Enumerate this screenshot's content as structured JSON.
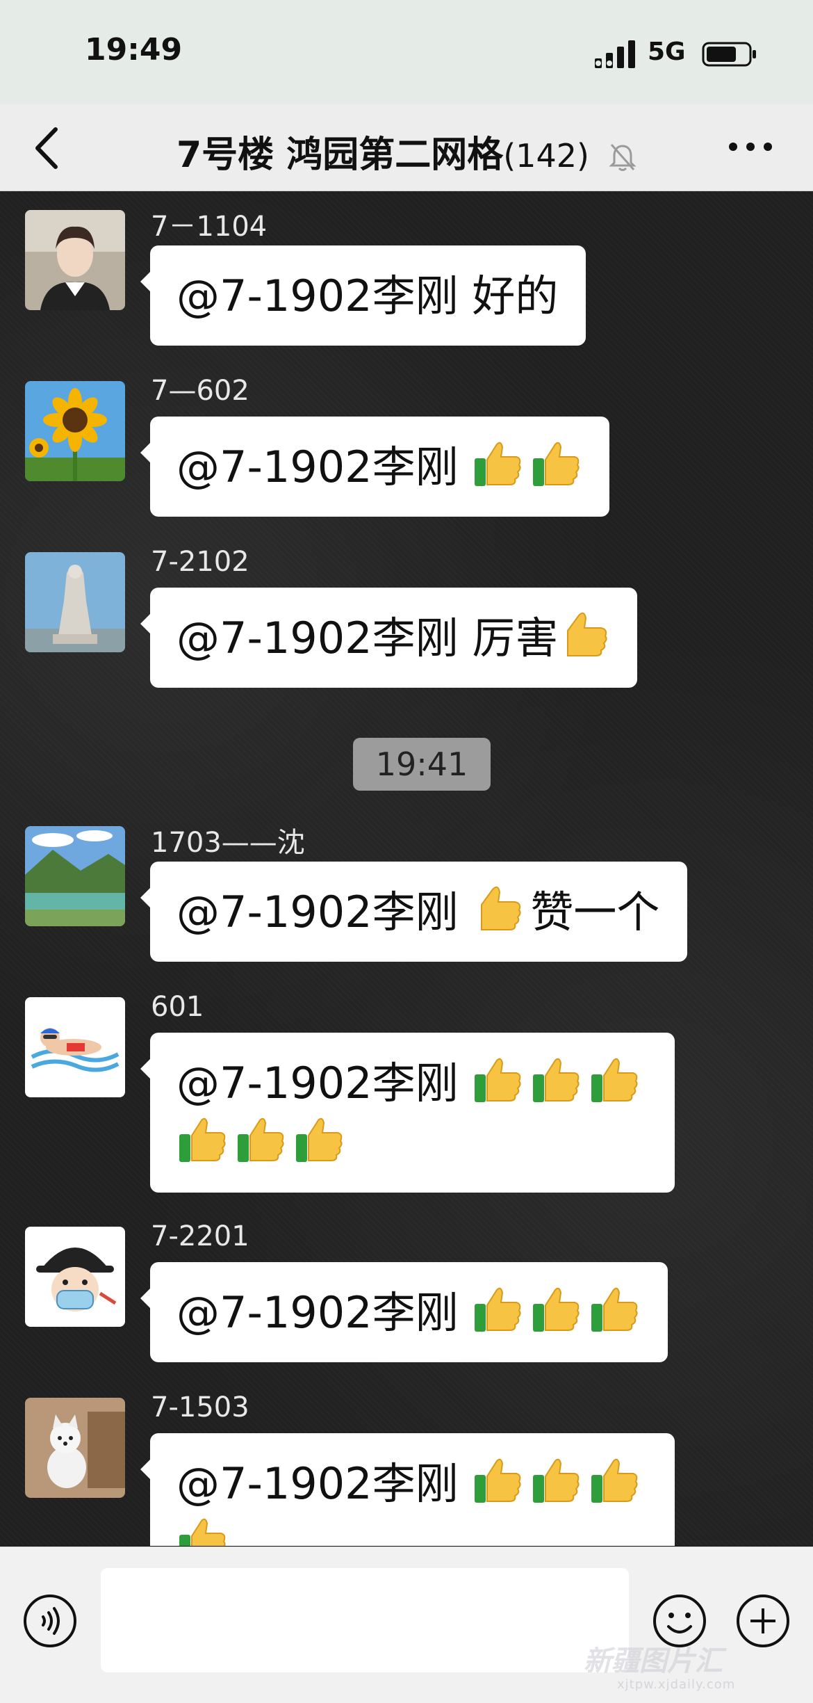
{
  "status_bar": {
    "time": "19:49",
    "network": "5G"
  },
  "header": {
    "title": "7号楼 鸿园第二网格",
    "member_count": "(142)"
  },
  "time_divider": "19:41",
  "messages": [
    {
      "sender": "7－1104",
      "mention": "@7-1902李刚",
      "text": " 好的",
      "thumbs_line1": 0,
      "thumbs_line2": 0,
      "avatar": "woman-portrait"
    },
    {
      "sender": "7—602",
      "mention": "@7-1902李刚",
      "text": " ",
      "thumbs_line1": 2,
      "thumbs_line2": 0,
      "avatar": "sunflower"
    },
    {
      "sender": "7-2102",
      "mention": "@7-1902李刚",
      "text": " 厉害",
      "thumbs_line1": 1,
      "thumbs_line2": 0,
      "avatar": "statue"
    },
    {
      "sender": "1703——沈",
      "mention": "@7-1902李刚",
      "text": " ",
      "suffix": "赞一个",
      "thumbs_line1": 1,
      "thumbs_line2": 0,
      "avatar": "landscape"
    },
    {
      "sender": "601",
      "mention": "@7-1902李刚",
      "text": " ",
      "thumbs_line1": 3,
      "thumbs_line2": 3,
      "avatar": "swimmer-cartoon"
    },
    {
      "sender": "7-2201",
      "mention": "@7-1902李刚",
      "text": " ",
      "thumbs_line1": 3,
      "thumbs_line2": 0,
      "avatar": "masked-cartoon"
    },
    {
      "sender": "7-1503",
      "mention": "@7-1902李刚",
      "text": " ",
      "thumbs_line1": 3,
      "thumbs_line2": 1,
      "avatar": "dog"
    }
  ],
  "watermark": {
    "text": "新疆图片汇",
    "url": "xjtpw.xjdaily.com"
  },
  "icons": {
    "back": "chevron-left-icon",
    "mute": "bell-muted-icon",
    "more": "more-dots-icon",
    "voice": "voice-icon",
    "emoji": "emoji-icon",
    "plus": "plus-icon",
    "thumb": "thumbs-up-emoji"
  },
  "colors": {
    "header_bg": "#ededed",
    "bubble": "#ffffff",
    "chat_bg": "#202020",
    "status_bg": "#e5ebe6"
  }
}
